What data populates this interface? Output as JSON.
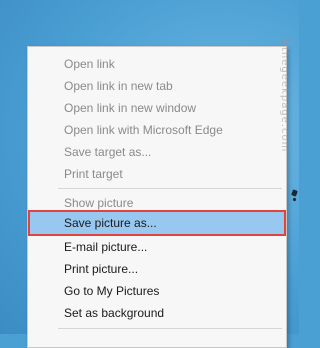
{
  "menu": {
    "items": [
      {
        "label": "Open link",
        "enabled": false
      },
      {
        "label": "Open link in new tab",
        "enabled": false
      },
      {
        "label": "Open link in new window",
        "enabled": false
      },
      {
        "label": "Open link with Microsoft Edge",
        "enabled": false
      },
      {
        "label": "Save target as...",
        "enabled": false
      },
      {
        "label": "Print target",
        "enabled": false
      },
      {
        "label": "Show picture",
        "enabled": false
      },
      {
        "label": "Save picture as...",
        "enabled": true,
        "highlighted": true
      },
      {
        "label": "E-mail picture...",
        "enabled": true
      },
      {
        "label": "Print picture...",
        "enabled": true
      },
      {
        "label": "Go to My Pictures",
        "enabled": true
      },
      {
        "label": "Set as background",
        "enabled": true
      }
    ]
  },
  "watermark": {
    "text": "@thegeekpage.com"
  },
  "colors": {
    "highlight_bg": "#98c8ef",
    "highlight_border": "#e0443c",
    "disabled_text": "#8a8a8a"
  }
}
